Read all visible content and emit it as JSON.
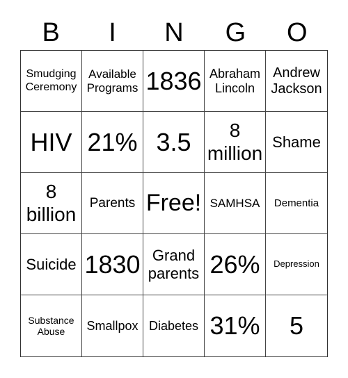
{
  "header": {
    "letters": [
      "B",
      "I",
      "N",
      "G",
      "O"
    ]
  },
  "cells": [
    [
      "Smudging Ceremony",
      "Available Programs",
      "1836",
      "Abraham Lincoln",
      "Andrew Jackson"
    ],
    [
      "HIV",
      "21%",
      "3.5",
      "8 million",
      "Shame"
    ],
    [
      "8 billion",
      "Parents",
      "Free!",
      "SAMHSA",
      "Dementia"
    ],
    [
      "Suicide",
      "1830",
      "Grand parents",
      "26%",
      "Depression"
    ],
    [
      "Substance Abuse",
      "Smallpox",
      "Diabetes",
      "31%",
      "5"
    ]
  ]
}
